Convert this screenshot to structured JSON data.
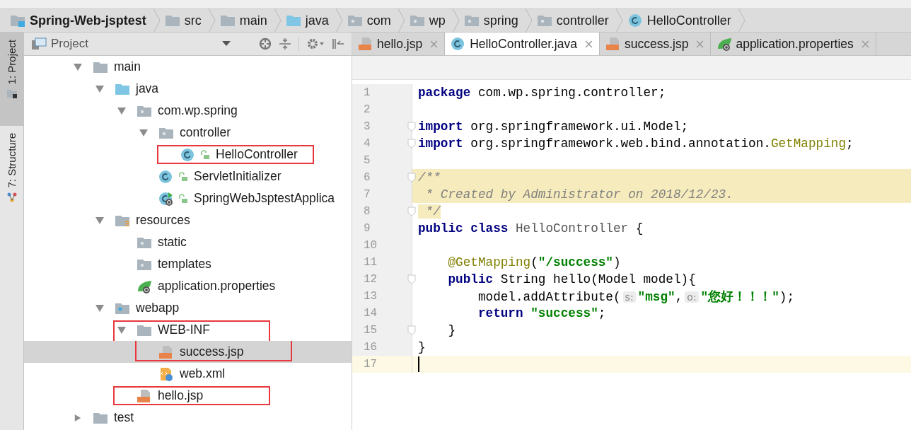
{
  "breadcrumbs": [
    {
      "label": "Spring-Web-jsptest",
      "kind": "project"
    },
    {
      "label": "src",
      "kind": "folder"
    },
    {
      "label": "main",
      "kind": "folder"
    },
    {
      "label": "java",
      "kind": "source"
    },
    {
      "label": "com",
      "kind": "package"
    },
    {
      "label": "wp",
      "kind": "package"
    },
    {
      "label": "spring",
      "kind": "package"
    },
    {
      "label": "controller",
      "kind": "package"
    },
    {
      "label": "HelloController",
      "kind": "class"
    }
  ],
  "tool_strip": [
    {
      "label": "1: Project",
      "selected": true
    },
    {
      "label": "7: Structure",
      "selected": false
    }
  ],
  "project_panel": {
    "title": "Project",
    "tree": [
      {
        "label": "main",
        "kind": "folder",
        "expanded": true,
        "selected": false,
        "children": [
          {
            "label": "java",
            "kind": "source",
            "expanded": true,
            "selected": false,
            "children": [
              {
                "label": "com.wp.spring",
                "kind": "package",
                "expanded": true,
                "selected": false,
                "children": [
                  {
                    "label": "controller",
                    "kind": "package",
                    "expanded": true,
                    "selected": false,
                    "children": [
                      {
                        "label": "HelloController",
                        "kind": "class",
                        "selected": false,
                        "boxed": true
                      }
                    ]
                  },
                  {
                    "label": "ServletInitializer",
                    "kind": "class",
                    "selected": false
                  },
                  {
                    "label": "SpringWebJsptestApplica",
                    "kind": "boot-class",
                    "selected": false
                  }
                ]
              }
            ]
          },
          {
            "label": "resources",
            "kind": "resources",
            "expanded": true,
            "selected": false,
            "children": [
              {
                "label": "static",
                "kind": "package",
                "selected": false
              },
              {
                "label": "templates",
                "kind": "package",
                "selected": false
              },
              {
                "label": "application.properties",
                "kind": "properties",
                "selected": false
              }
            ]
          },
          {
            "label": "webapp",
            "kind": "webapp",
            "expanded": true,
            "selected": false,
            "children": [
              {
                "label": "WEB-INF",
                "kind": "folder",
                "expanded": true,
                "selected": false,
                "boxed": true,
                "children": [
                  {
                    "label": "success.jsp",
                    "kind": "jsp",
                    "selected": true,
                    "boxed": true
                  },
                  {
                    "label": "web.xml",
                    "kind": "xml",
                    "selected": false
                  }
                ]
              },
              {
                "label": "hello.jsp",
                "kind": "jsp",
                "selected": false,
                "boxed": true
              }
            ]
          }
        ]
      },
      {
        "label": "test",
        "kind": "folder",
        "expanded": false,
        "selected": false
      }
    ]
  },
  "editor_tabs": [
    {
      "label": "hello.jsp",
      "kind": "jsp",
      "selected": false
    },
    {
      "label": "HelloController.java",
      "kind": "class",
      "selected": true
    },
    {
      "label": "success.jsp",
      "kind": "jsp",
      "selected": false
    },
    {
      "label": "application.properties",
      "kind": "properties",
      "selected": false
    }
  ],
  "code_lines": [
    {
      "number": "1",
      "tokens": [
        {
          "kind": "kw",
          "text": "package"
        },
        {
          "kind": "plain",
          "text": " com.wp.spring.controller;"
        }
      ]
    },
    {
      "number": "2"
    },
    {
      "number": "3",
      "fold": true,
      "tokens": [
        {
          "kind": "kw",
          "text": "import"
        },
        {
          "kind": "plain",
          "text": " org.springframework.ui.Model;"
        }
      ]
    },
    {
      "number": "4",
      "fold": true,
      "tokens": [
        {
          "kind": "kw",
          "text": "import"
        },
        {
          "kind": "plain",
          "text": " org.springframework.web.bind.annotation."
        },
        {
          "kind": "ann",
          "text": "GetMapping"
        },
        {
          "kind": "plain",
          "text": ";"
        }
      ]
    },
    {
      "number": "5"
    },
    {
      "number": "6",
      "fold": true,
      "highlighted": true,
      "tokens": [
        {
          "kind": "comment",
          "text": "/**"
        }
      ]
    },
    {
      "number": "7",
      "highlighted": true,
      "tokens": [
        {
          "kind": "comment",
          "text": " * Created by Administrator on 2018/12/23."
        }
      ]
    },
    {
      "number": "8",
      "fold": true,
      "tokens": [
        {
          "kind": "comment-marked",
          "text": " */"
        }
      ]
    },
    {
      "number": "9",
      "tokens": [
        {
          "kind": "kw",
          "text": "public class"
        },
        {
          "kind": "type",
          "text": " HelloController"
        },
        {
          "kind": "plain",
          "text": " {"
        }
      ]
    },
    {
      "number": "10"
    },
    {
      "number": "11",
      "tokens": [
        {
          "kind": "ann",
          "text": "    @GetMapping"
        },
        {
          "kind": "plain",
          "text": "("
        },
        {
          "kind": "str",
          "text": "\"/success\""
        },
        {
          "kind": "plain",
          "text": ")"
        }
      ]
    },
    {
      "number": "12",
      "fold": true,
      "tokens": [
        {
          "kind": "kw",
          "text": "    public"
        },
        {
          "kind": "plain",
          "text": " String hello(Model model){"
        }
      ]
    },
    {
      "number": "13",
      "tokens": [
        {
          "kind": "plain",
          "text": "        model.addAttribute("
        },
        {
          "kind": "hint",
          "text": "s:"
        },
        {
          "kind": "str",
          "text": "\"msg\""
        },
        {
          "kind": "plain",
          "text": ","
        },
        {
          "kind": "hint",
          "text": "o:"
        },
        {
          "kind": "str",
          "text": "\"您好！！！\""
        },
        {
          "kind": "plain",
          "text": ");"
        }
      ]
    },
    {
      "number": "14",
      "tokens": [
        {
          "kind": "kw",
          "text": "        return"
        },
        {
          "kind": "str",
          "text": " \"success\""
        },
        {
          "kind": "plain",
          "text": ";"
        }
      ]
    },
    {
      "number": "15",
      "fold": true,
      "tokens": [
        {
          "kind": "plain",
          "text": "    }"
        }
      ]
    },
    {
      "number": "16",
      "tokens": [
        {
          "kind": "plain",
          "text": "}"
        }
      ]
    },
    {
      "number": "17",
      "current": true
    }
  ]
}
